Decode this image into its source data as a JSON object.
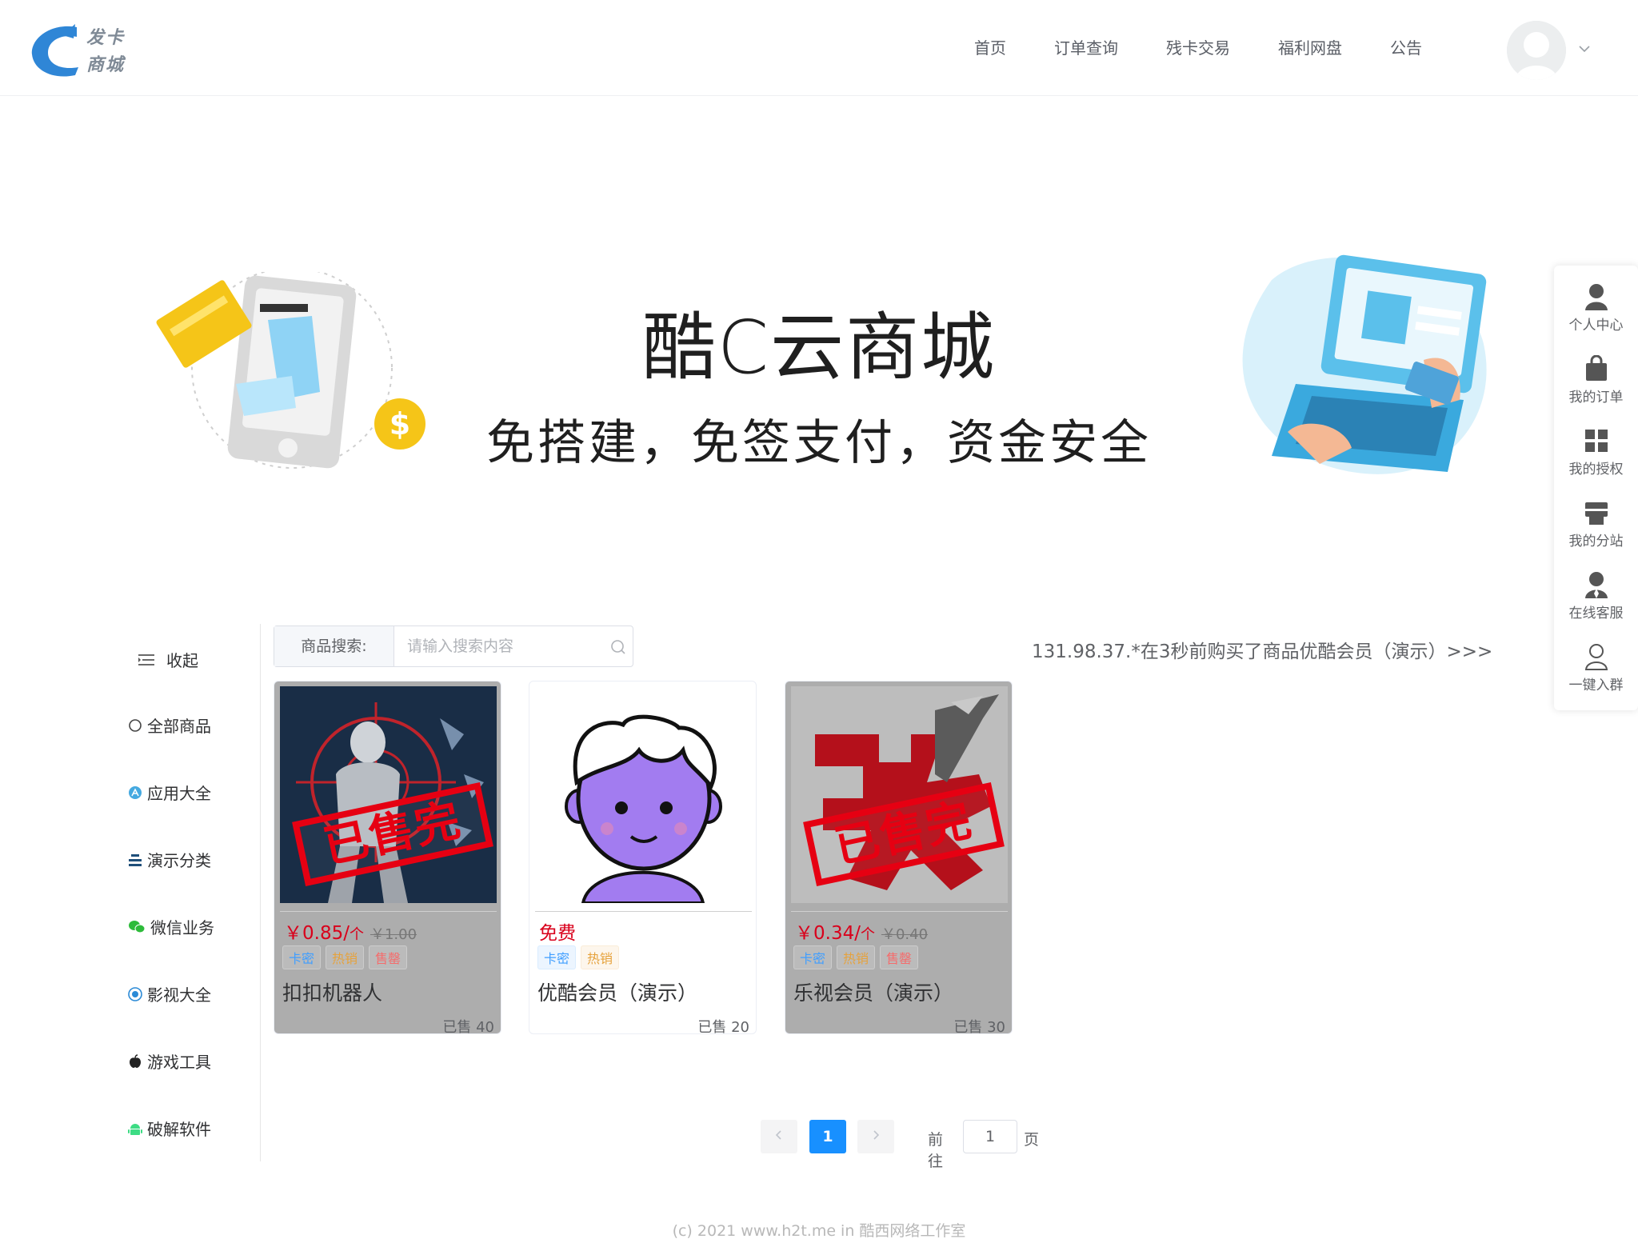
{
  "header": {
    "logo_text_line1": "发卡",
    "logo_text_line2": "商城",
    "nav": [
      "首页",
      "订单查询",
      "残卡交易",
      "福利网盘",
      "公告"
    ]
  },
  "banner": {
    "title": "酷C云商城",
    "subtitle": "免搭建，免签支付，资金安全"
  },
  "float_panel": [
    "个人中心",
    "我的订单",
    "我的授权",
    "我的分站",
    "在线客服",
    "一键入群"
  ],
  "sidebar": {
    "collapse_label": "收起",
    "items": [
      "全部商品",
      "应用大全",
      "演示分类",
      "微信业务",
      "影视大全",
      "游戏工具",
      "破解软件"
    ]
  },
  "search": {
    "label": "商品搜索:",
    "placeholder": "请输入搜索内容"
  },
  "ticker": "131.98.37.*在3秒前购买了商品优酷会员（演示）>>>",
  "products": [
    {
      "price": "￥0.85/",
      "unit": "个",
      "orig": "￥1.00",
      "tags": [
        "卡密",
        "热销",
        "售罄"
      ],
      "name": "扣扣机器人",
      "sold": "已售 40",
      "stamp": "已售完"
    },
    {
      "price": "免费",
      "unit": "",
      "orig": "",
      "tags": [
        "卡密",
        "热销"
      ],
      "name": "优酷会员（演示）",
      "sold": "已售 20"
    },
    {
      "price": "￥0.34/",
      "unit": "个",
      "orig": "￥0.40",
      "tags": [
        "卡密",
        "热销",
        "售罄"
      ],
      "name": "乐视会员（演示）",
      "sold": "已售 30",
      "stamp": "已售完"
    }
  ],
  "pagination": {
    "current": "1",
    "goto_label": "前往",
    "goto_value": "1",
    "page_label": "页"
  },
  "footer": "(c) 2021 www.h2t.me in 酷西网络工作室",
  "colors": {
    "accent": "#1890ff",
    "price": "#d9001b",
    "stamp": "#e60012"
  }
}
